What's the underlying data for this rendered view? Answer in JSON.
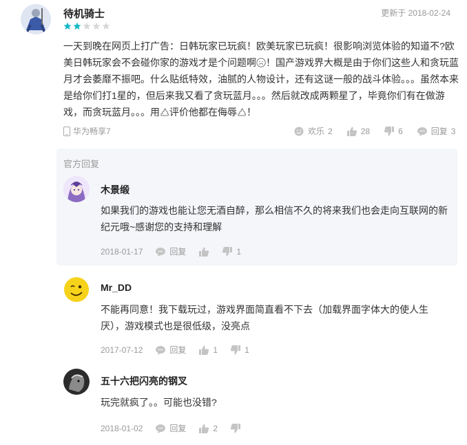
{
  "review": {
    "username": "待机骑士",
    "updated": "更新于 2018-02-24",
    "rating": 2,
    "max_rating": 5,
    "text_part1": "一天到晚在网页上打广告：日韩玩家已玩疯！欧美玩家已玩疯！很影响浏览体验的知道不?欧美日韩玩家会不会碰你家的游戏才是个问题啊",
    "text_part2": "！国产游戏界大概是由于你们这些人和贪玩蓝月才会萎靡不振吧。什么贴纸特效，油腻的人物设计，还有这谜一般的战斗体验。。。虽然本来是给你们打1星的，但后来我又看了贪玩蓝月。。。然后就改成两颗星了，毕竟你们有在做游戏，而贪玩蓝月。。。用",
    "text_part3": "评价他都在侮辱",
    "text_part4": "！",
    "device": "华为畅享7",
    "happy_label": "欢乐",
    "happy_count": "2",
    "like_count": "28",
    "dislike_count": "6",
    "reply_label": "回复",
    "reply_count": "3"
  },
  "official_reply": {
    "label": "官方回复",
    "username": "木景缎",
    "text": "如果我们的游戏也能让您无酒自醉，那么相信不久的将来我们也会走向互联网的新纪元哦~感谢您的支持和理解",
    "date": "2018-01-17",
    "reply_label": "回复",
    "dislike_count": "1"
  },
  "replies": [
    {
      "username": "Mr_DD",
      "text": "不能再同意！我下载玩过，游戏界面简直看不下去（加载界面字体大的使人生厌），游戏模式也是很低级，没亮点",
      "date": "2017-07-12",
      "reply_label": "回复",
      "like_count": "1",
      "dislike_count": "1"
    },
    {
      "username": "五十六把闪亮的钢叉",
      "text": "玩完就疯了。。可能也没错?",
      "date": "2018-01-02",
      "reply_label": "回复",
      "like_count": "2",
      "dislike_count": ""
    }
  ],
  "colors": {
    "star_on": "#14b9c8",
    "star_off": "#d8d8d8",
    "official_bg": "#f4f6f9"
  },
  "icons": {
    "device": "phone-icon",
    "happy": "smiley-icon",
    "like": "thumbs-up-icon",
    "dislike": "thumbs-down-icon",
    "reply": "speech-bubble-icon"
  }
}
